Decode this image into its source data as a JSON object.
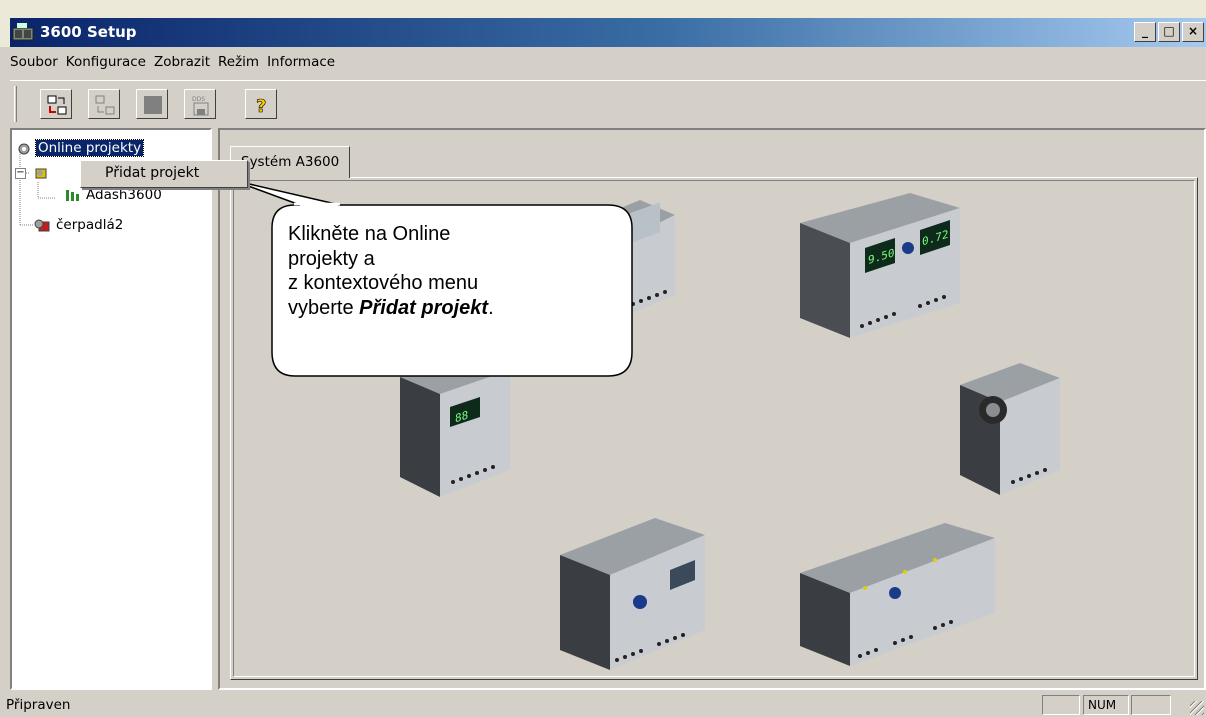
{
  "window": {
    "title": "3600 Setup"
  },
  "menu": [
    "Soubor",
    "Konfigurace",
    "Zobrazit",
    "Režim",
    "Informace"
  ],
  "tree": {
    "root": "Online projekty",
    "child1": "Adash3600",
    "child2": "čerpadlá2"
  },
  "context_menu": {
    "item": "Přidat projekt"
  },
  "tab": {
    "label": "Systém A3600"
  },
  "callout": {
    "line1": "Klikněte na Online",
    "line2": "projekty a",
    "line3": "z kontextového menu",
    "line4_prefix": "vyberte ",
    "line4_bold": "Přidat projekt",
    "line4_suffix": "."
  },
  "devices": {
    "display1": "9.50",
    "display2": "0.72",
    "display3": "88"
  },
  "status": {
    "text": "Připraven",
    "num": "NUM"
  },
  "colors": {
    "title_start": "#0a246a",
    "title_end": "#a6caf0",
    "face": "#d4d0c8",
    "selection": "#0a246a"
  }
}
